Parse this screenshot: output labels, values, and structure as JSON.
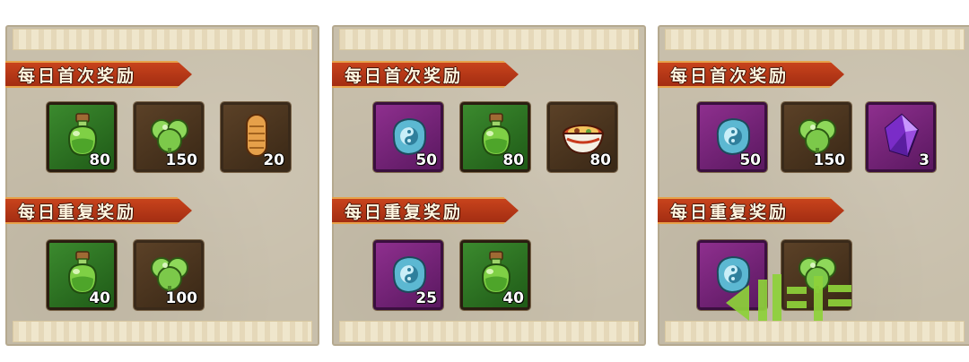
{
  "colors": {
    "banner_red": "#b5381a",
    "frame_green": "#2f7a25",
    "frame_brown": "#4a3420",
    "frame_purple": "#7a2680",
    "panel_bg": "#c8bfab",
    "watermark_green": "#8ed23a"
  },
  "panels": [
    {
      "first": {
        "title": "每日首次奖励",
        "items": [
          {
            "icon": "green-potion-icon",
            "count": "80"
          },
          {
            "icon": "green-clover-icon",
            "count": "150"
          },
          {
            "icon": "wooden-scroll-icon",
            "count": "20"
          }
        ]
      },
      "repeat": {
        "title": "每日重复奖励",
        "items": [
          {
            "icon": "green-potion-icon",
            "count": "40"
          },
          {
            "icon": "green-clover-icon",
            "count": "100"
          }
        ]
      }
    },
    {
      "first": {
        "title": "每日首次奖励",
        "items": [
          {
            "icon": "yin-yang-stone-icon",
            "count": "50"
          },
          {
            "icon": "green-potion-icon",
            "count": "80"
          },
          {
            "icon": "ramen-bowl-icon",
            "count": "80"
          }
        ]
      },
      "repeat": {
        "title": "每日重复奖励",
        "items": [
          {
            "icon": "yin-yang-stone-icon",
            "count": "25"
          },
          {
            "icon": "green-potion-icon",
            "count": "40"
          }
        ]
      }
    },
    {
      "first": {
        "title": "每日首次奖励",
        "items": [
          {
            "icon": "yin-yang-stone-icon",
            "count": "50"
          },
          {
            "icon": "green-clover-icon",
            "count": "150"
          },
          {
            "icon": "purple-crystal-icon",
            "count": "3"
          }
        ]
      },
      "repeat": {
        "title": "每日重复奖励",
        "items": [
          {
            "icon": "yin-yang-stone-icon",
            "count": ""
          },
          {
            "icon": "green-clover-icon",
            "count": ""
          }
        ]
      }
    }
  ]
}
